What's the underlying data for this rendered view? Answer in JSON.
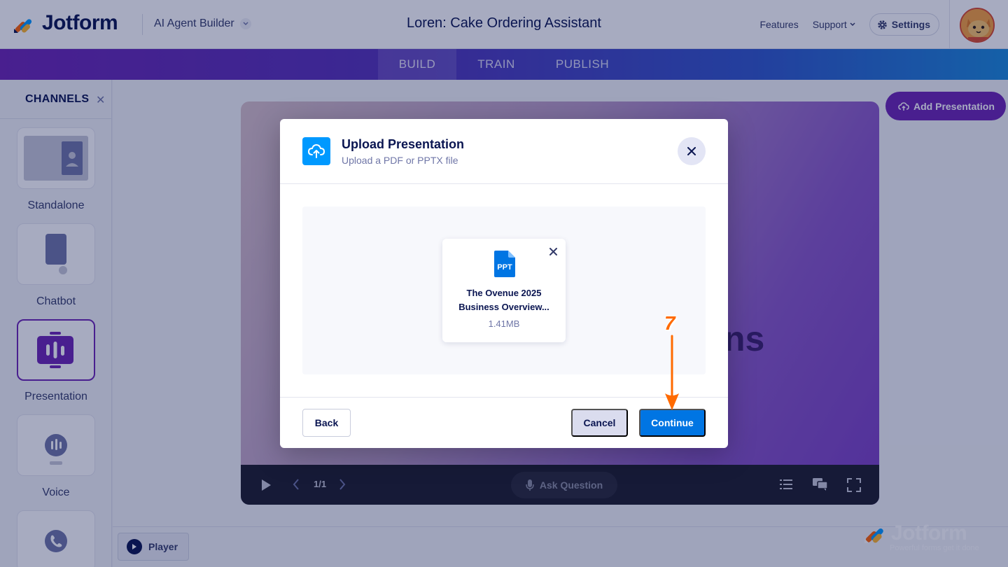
{
  "header": {
    "logo_text": "Jotform",
    "product_name": "AI Agent Builder",
    "page_title": "Loren: Cake Ordering Assistant",
    "nav_features": "Features",
    "nav_support": "Support",
    "nav_settings": "Settings"
  },
  "tabs": [
    {
      "label": "BUILD",
      "active": true
    },
    {
      "label": "TRAIN",
      "active": false
    },
    {
      "label": "PUBLISH",
      "active": false
    }
  ],
  "sidebar": {
    "title": "CHANNELS",
    "items": [
      {
        "label": "Standalone",
        "active": false
      },
      {
        "label": "Chatbot",
        "active": false
      },
      {
        "label": "Presentation",
        "active": true
      },
      {
        "label": "Voice",
        "active": false
      },
      {
        "label": "",
        "active": false
      }
    ]
  },
  "main": {
    "add_presentation_label": "Add Presentation",
    "slide_text_fragment": "ns",
    "page_counter": "1/1",
    "ask_question_label": "Ask Question",
    "player_button_label": "Player"
  },
  "watermark": {
    "brand": "Jotform",
    "tagline": "Powerful forms get it done"
  },
  "modal": {
    "title": "Upload Presentation",
    "subtitle": "Upload a PDF or PPTX file",
    "file": {
      "type_badge": "PPT",
      "name_line1": "The Ovenue 2025",
      "name_line2": "Business Overview...",
      "size": "1.41MB"
    },
    "back_label": "Back",
    "cancel_label": "Cancel",
    "continue_label": "Continue"
  },
  "annotation": {
    "step_number": "7"
  },
  "colors": {
    "brand_purple": "#6c25b3",
    "primary_blue": "#0075e3",
    "upload_blue": "#0099ff",
    "navy": "#0a1551",
    "annotation_orange": "#ff6a00"
  }
}
